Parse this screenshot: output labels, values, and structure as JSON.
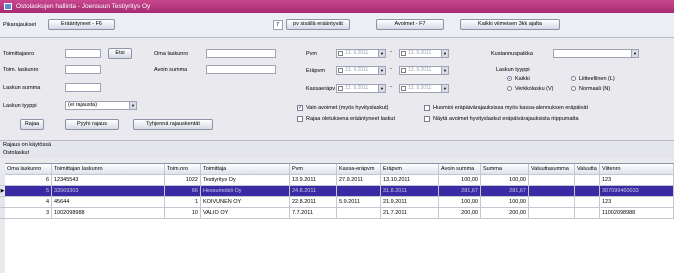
{
  "window": {
    "title": "Ostolaskujen hallinta - Joensuun Testiyritys Oy"
  },
  "toolbar": {
    "section_label": "Pikarajaukset",
    "btn_unpaid": "Erääntyneet - F6",
    "days_value": "7",
    "btn_days": "pv sisällä erääntyvät",
    "btn_open": "Avoimet - F7",
    "btn_all": "Kaikki viimeisen 3kk ajalta"
  },
  "filters": {
    "supplier_no_label": "Toimittajanro",
    "search_btn": "Etsi",
    "own_invoice_label": "Oma laskunro",
    "invoice_no_label": "Toim. laskunro",
    "open_sum_label": "Avoin summa",
    "invoice_sum_label": "Laskun summa",
    "type_label": "Laskun tyyppi",
    "type_value": "(ei rajausta)",
    "cost_center_label": "Kustannuspaikka",
    "pvm_label": "Pvm",
    "due_label": "Eräpvm",
    "cash_due_label": "Kassaeräpv",
    "date_placeholder": "13. 9.2011",
    "invoice_type_title": "Laskun tyyppi",
    "radio_all": "Kaikki",
    "radio_attachment": "Liitteellinen (L)",
    "radio_einvoice": "Verkkolasku (V)",
    "radio_normal": "Normaali (N)",
    "chk_only_open": "Vain avoimet (myös hyvityslaskut)",
    "chk_limit_due": "Rajaa oletuksena erääntyneet laskut",
    "chk_cash_discount": "Huomioi eräpäivärajauksissa myös kassa-alennuksen eräpäivät",
    "chk_show_credit": "Näytä avoimet hyvityslaskut eräpäivärajauksista riippumatta",
    "btn_filter": "Rajaa",
    "btn_clear": "Pyyhi rajaus",
    "btn_clear_all": "Tyhjennä rajauskentät"
  },
  "section": {
    "label": "Rajaus on käytössä",
    "title": "Ostolaskut"
  },
  "table": {
    "columns": [
      "Oma laskunro",
      "Toimittajan laskunro",
      "Toim.nro",
      "Toimittaja",
      "Pvm",
      "Kassa-eräpvm",
      "Eräpvm",
      "Avoin summa",
      "Summa",
      "Valuuttasumma",
      "Valuutta",
      "Viitenro"
    ],
    "rows": [
      [
        "6",
        "12345543",
        "1022",
        "Testiyritys Oy",
        "13.9.2011",
        "27.9.2011",
        "13.10.2011",
        "100,00",
        "100,00",
        "",
        "",
        "123"
      ],
      [
        "5",
        "33569303",
        "66",
        "Hessumobili Oy",
        "24.8.2011",
        "",
        "31.8.2011",
        "281,67",
        "281,67",
        "",
        "",
        "307099460033"
      ],
      [
        "4",
        "45644",
        "1",
        "KOIVUNEN OY",
        "22.8.2011",
        "5.9.2011",
        "21.9.2011",
        "100,00",
        "100,00",
        "",
        "",
        "123"
      ],
      [
        "3",
        "1002098988",
        "10",
        "VALIO OY",
        "7.7.2011",
        "",
        "21.7.2011",
        "200,00",
        "200,00",
        "",
        "",
        "11002098988"
      ]
    ]
  },
  "colors": {
    "title_bar": "#b8357f",
    "selected_row": "#3a2ba4"
  }
}
